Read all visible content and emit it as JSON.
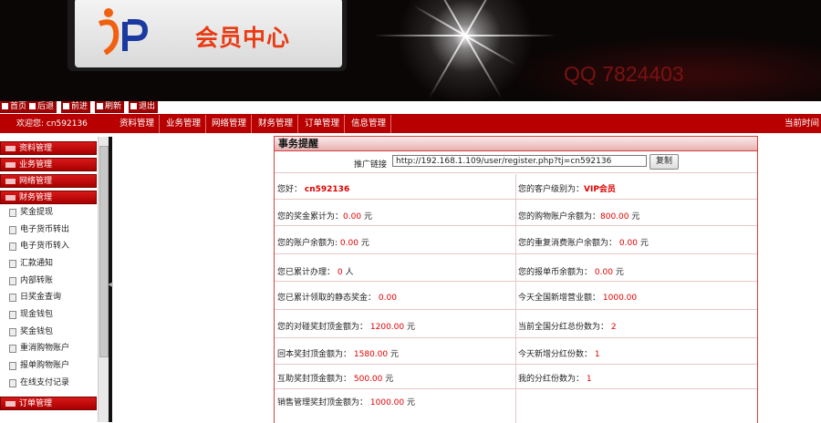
{
  "banner": {
    "logo_text": "会员中心",
    "qq": "QQ 7824403"
  },
  "nav_buttons": [
    {
      "label": "首页",
      "icon": "home-icon"
    },
    {
      "label": "后退",
      "icon": "back-arrow-icon"
    },
    {
      "label": "前进",
      "icon": "forward-arrow-icon"
    },
    {
      "label": "刷新",
      "icon": "refresh-icon"
    },
    {
      "label": "退出",
      "icon": "power-icon"
    }
  ],
  "menubar": {
    "welcome": "欢迎您: cn592136",
    "items": [
      "资料管理",
      "业务管理",
      "网络管理",
      "财务管理",
      "订单管理",
      "信息管理"
    ],
    "current_time_label": "当前时间"
  },
  "sidebar": {
    "categories": [
      "资料管理",
      "业务管理",
      "网络管理",
      "财务管理"
    ],
    "finance_items": [
      "奖金提现",
      "电子货币转出",
      "电子货币转入",
      "汇款通知",
      "内部转账",
      "日奖金查询",
      "现金钱包",
      "奖金钱包",
      "重消购物账户",
      "报单购物账户",
      "在线支付记录"
    ],
    "bottom_category": "订单管理"
  },
  "panel": {
    "title": "事务提醒",
    "promo_label": "推广链接",
    "promo_url": "http://192.168.1.109/user/register.php?tj=cn592136",
    "copy_button": "复制",
    "hello_label": "您好：",
    "username": "cn592136",
    "level_label": "您的客户级别为：",
    "level_value": "VIP会员",
    "rows": [
      {
        "l_label": "您的奖金累计为：",
        "l_value": "0.00",
        "l_unit": "元",
        "r_label": "您的购物账户余额为：",
        "r_value": "800.00",
        "r_unit": "元"
      },
      {
        "l_label": "您的账户余额为:",
        "l_value": "0.00",
        "l_unit": "元",
        "r_label": "您的重复消费账户余额为：",
        "r_value": "0.00",
        "r_unit": "元"
      },
      {
        "l_label": "您已累计办理：",
        "l_value": "0",
        "l_unit": "人",
        "r_label": "您的报单币余额为：",
        "r_value": "0.00",
        "r_unit": "元"
      },
      {
        "l_label": "您已累计领取的静态奖金：",
        "l_value": "0.00",
        "l_unit": "",
        "r_label": "今天全国新增营业额：",
        "r_value": "1000.00",
        "r_unit": ""
      },
      {
        "l_label": "您的对碰奖封顶金额为：",
        "l_value": "1200.00",
        "l_unit": "元",
        "r_label": "当前全国分红总份数为：",
        "r_value": "2",
        "r_unit": ""
      },
      {
        "l_label": "回本奖封顶金额为：",
        "l_value": "1580.00",
        "l_unit": "元",
        "r_label": "今天新增分红份数：",
        "r_value": "1",
        "r_unit": ""
      },
      {
        "l_label": "互助奖封顶金额为：",
        "l_value": "500.00",
        "l_unit": "元",
        "r_label": "我的分红份数为：",
        "r_value": "1",
        "r_unit": ""
      },
      {
        "l_label": "销售管理奖封顶金额为：",
        "l_value": "1000.00",
        "l_unit": "元",
        "r_label": "",
        "r_value": "",
        "r_unit": ""
      }
    ]
  },
  "colors": {
    "brand_red": "#b80000",
    "value_red": "#e00000",
    "logo_orange": "#ea3a12",
    "qq_red": "#7a1212"
  }
}
